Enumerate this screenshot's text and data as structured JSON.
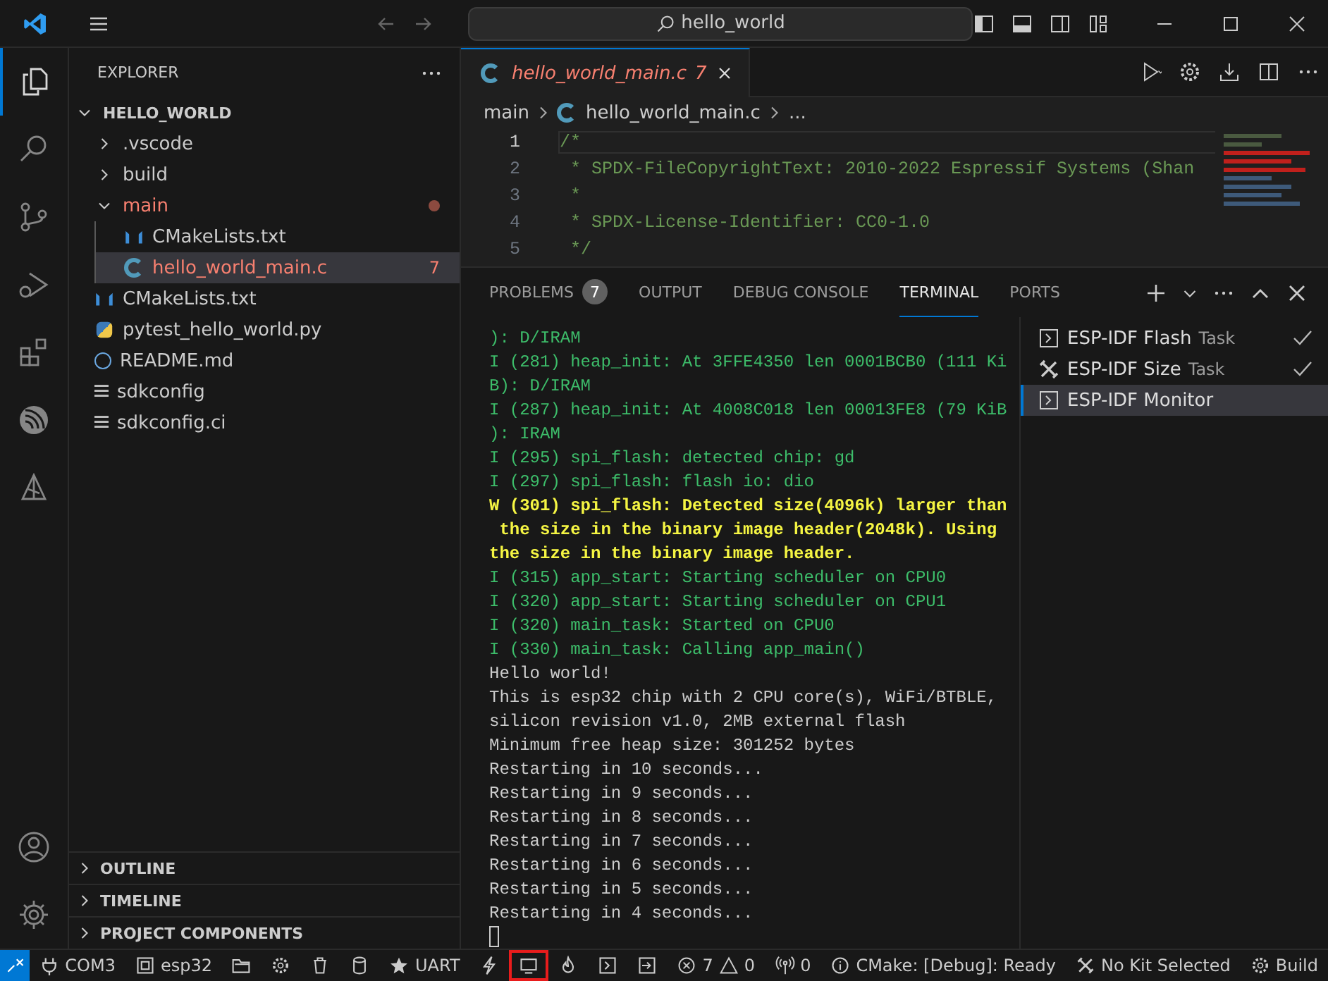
{
  "title_bar": {
    "search": "hello_world"
  },
  "activity_bar": {
    "items": [
      {
        "kind": "files",
        "selected": true
      },
      {
        "kind": "search",
        "selected": false
      },
      {
        "kind": "branch",
        "selected": false
      },
      {
        "kind": "debug",
        "selected": false
      },
      {
        "kind": "extensions",
        "selected": false
      },
      {
        "kind": "espressif",
        "selected": false
      },
      {
        "kind": "idf",
        "selected": false
      }
    ],
    "bottom": [
      {
        "kind": "account"
      },
      {
        "kind": "settings"
      }
    ]
  },
  "sidebar": {
    "title": "EXPLORER",
    "root": {
      "label": "HELLO_WORLD",
      "expanded": true,
      "children": [
        {
          "label": ".vscode",
          "kind": "folder",
          "expanded": false
        },
        {
          "label": "build",
          "kind": "folder",
          "expanded": false
        },
        {
          "label": "main",
          "kind": "folder",
          "expanded": true,
          "error": true,
          "children": [
            {
              "label": "CMakeLists.txt",
              "kind": "cmake",
              "selected": false
            },
            {
              "label": "hello_world_main.c",
              "kind": "c",
              "error": true,
              "badge": "7",
              "selected": true
            }
          ]
        },
        {
          "label": "CMakeLists.txt",
          "kind": "cmake",
          "selected": false
        },
        {
          "label": "pytest_hello_world.py",
          "kind": "python",
          "selected": false
        },
        {
          "label": "README.md",
          "kind": "info",
          "selected": false
        },
        {
          "label": "sdkconfig",
          "kind": "lines",
          "selected": false
        },
        {
          "label": "sdkconfig.ci",
          "kind": "lines",
          "selected": false
        }
      ]
    },
    "sections": [
      {
        "label": "OUTLINE",
        "expanded": false
      },
      {
        "label": "TIMELINE",
        "expanded": false
      },
      {
        "label": "PROJECT COMPONENTS",
        "expanded": false
      }
    ]
  },
  "editor": {
    "tabs": [
      {
        "label": "hello_world_main.c",
        "badge": "7",
        "error": true,
        "selected": true
      }
    ],
    "breadcrumb": [
      "main",
      "hello_world_main.c",
      "..."
    ],
    "lines": [
      {
        "number": "1",
        "text": "/*",
        "current": true
      },
      {
        "number": "2",
        "text": " * SPDX-FileCopyrightText: 2010-2022 Espressif Systems (Shan",
        "current": false
      },
      {
        "number": "3",
        "text": " *",
        "current": false
      },
      {
        "number": "4",
        "text": " * SPDX-License-Identifier: CC0-1.0",
        "current": false
      },
      {
        "number": "5",
        "text": " */",
        "current": false
      }
    ]
  },
  "panel": {
    "tabs": [
      {
        "label": "PROBLEMS",
        "badge": "7",
        "selected": false
      },
      {
        "label": "OUTPUT",
        "selected": false
      },
      {
        "label": "DEBUG CONSOLE",
        "selected": false
      },
      {
        "label": "TERMINAL",
        "selected": true
      },
      {
        "label": "PORTS",
        "selected": false
      }
    ],
    "terminal": [
      {
        "kind": "info",
        "text": "): D/IRAM"
      },
      {
        "kind": "info",
        "text": "I (281) heap_init: At 3FFE4350 len 0001BCB0 (111 Ki"
      },
      {
        "kind": "info",
        "text": "B): D/IRAM"
      },
      {
        "kind": "info",
        "text": "I (287) heap_init: At 4008C018 len 00013FE8 (79 KiB"
      },
      {
        "kind": "info",
        "text": "): IRAM"
      },
      {
        "kind": "info",
        "text": "I (295) spi_flash: detected chip: gd"
      },
      {
        "kind": "info",
        "text": "I (297) spi_flash: flash io: dio"
      },
      {
        "kind": "warn",
        "text": "W (301) spi_flash: Detected size(4096k) larger than"
      },
      {
        "kind": "warn",
        "text": " the size in the binary image header(2048k). Using"
      },
      {
        "kind": "warn",
        "text": "the size in the binary image header."
      },
      {
        "kind": "info",
        "text": "I (315) app_start: Starting scheduler on CPU0"
      },
      {
        "kind": "info",
        "text": "I (320) app_start: Starting scheduler on CPU1"
      },
      {
        "kind": "info",
        "text": "I (320) main_task: Started on CPU0"
      },
      {
        "kind": "info",
        "text": "I (330) main_task: Calling app_main()"
      },
      {
        "kind": "plain",
        "text": "Hello world!"
      },
      {
        "kind": "plain",
        "text": "This is esp32 chip with 2 CPU core(s), WiFi/BTBLE,"
      },
      {
        "kind": "plain",
        "text": "silicon revision v1.0, 2MB external flash"
      },
      {
        "kind": "plain",
        "text": "Minimum free heap size: 301252 bytes"
      },
      {
        "kind": "plain",
        "text": "Restarting in 10 seconds..."
      },
      {
        "kind": "plain",
        "text": "Restarting in 9 seconds..."
      },
      {
        "kind": "plain",
        "text": "Restarting in 8 seconds..."
      },
      {
        "kind": "plain",
        "text": "Restarting in 7 seconds..."
      },
      {
        "kind": "plain",
        "text": "Restarting in 6 seconds..."
      },
      {
        "kind": "plain",
        "text": "Restarting in 5 seconds..."
      },
      {
        "kind": "plain",
        "text": "Restarting in 4 seconds..."
      }
    ],
    "tasks": [
      {
        "kind": "terminal",
        "label": "ESP-IDF Flash",
        "detail": "Task",
        "done": true,
        "selected": false
      },
      {
        "kind": "tools",
        "label": "ESP-IDF Size",
        "detail": "Task",
        "done": true,
        "selected": false
      },
      {
        "kind": "terminal",
        "label": "ESP-IDF Monitor",
        "selected": true,
        "done": false
      }
    ]
  },
  "status_bar": [
    {
      "kind": "remote",
      "highlighted": false
    },
    {
      "kind": "plug",
      "label": "COM3",
      "highlighted": false
    },
    {
      "kind": "chip",
      "label": "esp32",
      "highlighted": false
    },
    {
      "kind": "folder",
      "highlighted": false
    },
    {
      "kind": "gear",
      "highlighted": false
    },
    {
      "kind": "trash",
      "highlighted": false
    },
    {
      "kind": "cylinder",
      "highlighted": false
    },
    {
      "kind": "star",
      "label": "UART",
      "highlighted": false
    },
    {
      "kind": "bolt",
      "highlighted": false
    },
    {
      "kind": "monitor",
      "highlighted": true
    },
    {
      "kind": "flame",
      "highlighted": false
    },
    {
      "kind": "terminal",
      "highlighted": false
    },
    {
      "kind": "enter",
      "highlighted": false
    },
    {
      "kind": "problems",
      "errors": "7",
      "warnings": "0",
      "highlighted": false
    },
    {
      "kind": "antenna",
      "label": "0",
      "highlighted": false
    },
    {
      "kind": "info",
      "label": "CMake: [Debug]: Ready",
      "highlighted": false
    },
    {
      "kind": "tools",
      "label": "No Kit Selected",
      "highlighted": false
    },
    {
      "kind": "gear",
      "label": "Build",
      "highlighted": false
    }
  ]
}
